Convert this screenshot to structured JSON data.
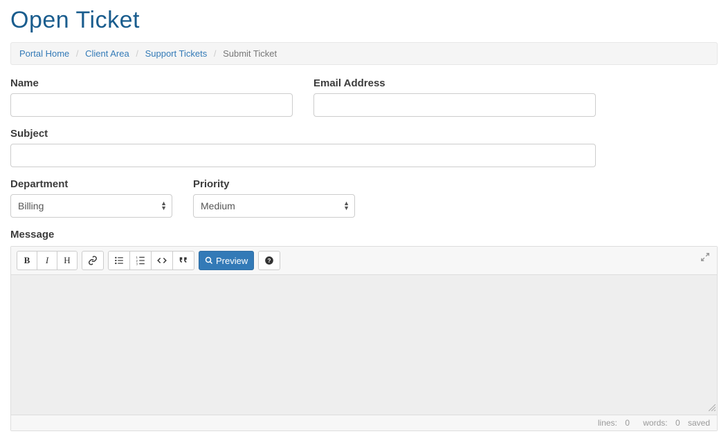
{
  "page": {
    "title": "Open Ticket"
  },
  "breadcrumb": {
    "portal_home": "Portal Home",
    "client_area": "Client Area",
    "support_tickets": "Support Tickets",
    "submit_ticket": "Submit Ticket"
  },
  "labels": {
    "name": "Name",
    "email": "Email Address",
    "subject": "Subject",
    "department": "Department",
    "priority": "Priority",
    "message": "Message"
  },
  "values": {
    "name": "",
    "email": "",
    "subject": "",
    "department": "Billing",
    "priority": "Medium"
  },
  "toolbar": {
    "bold": "B",
    "italic": "I",
    "heading": "H",
    "preview": "Preview"
  },
  "status": {
    "lines_label": "lines:",
    "lines_value": "0",
    "words_label": "words:",
    "words_value": "0",
    "saved": "saved"
  }
}
